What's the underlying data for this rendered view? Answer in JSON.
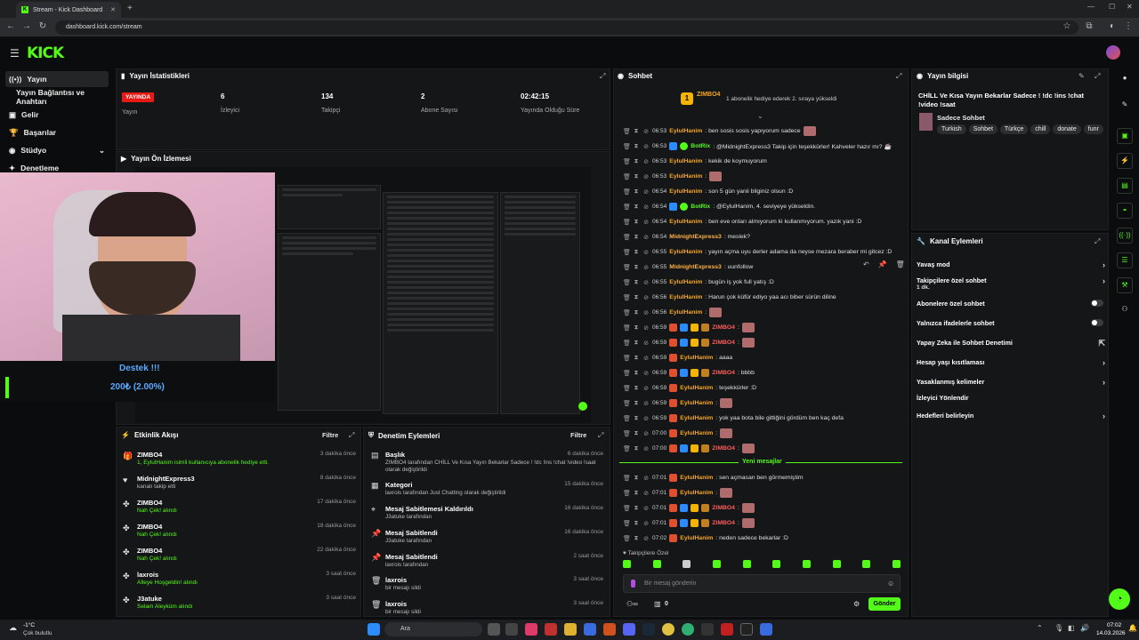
{
  "browser": {
    "tab_title": "Stream - Kick Dashboard",
    "url": "dashboard.kick.com/stream"
  },
  "brand": {
    "logo": "KICK",
    "accent": "#53fc18"
  },
  "sidebar": {
    "items": [
      {
        "label": "Yayın",
        "icon": "broadcast-icon"
      },
      {
        "label": "Yayın Bağlantısı ve Anahtarı",
        "icon": "key-icon"
      },
      {
        "label": "Gelir",
        "icon": "wallet-icon"
      },
      {
        "label": "Başarılar",
        "icon": "trophy-icon"
      },
      {
        "label": "Stüdyo",
        "icon": "studio-icon"
      },
      {
        "label": "Denetleme",
        "icon": "shield-icon"
      }
    ]
  },
  "stats": {
    "title": "Yayın İstatistikleri",
    "live_badge": "YAYINDA",
    "items": [
      {
        "label": "Yayın",
        "value": ""
      },
      {
        "label": "İzleyici",
        "value": "6"
      },
      {
        "label": "Takipçi",
        "value": "134"
      },
      {
        "label": "Abone Sayısı",
        "value": "2"
      },
      {
        "label": "Yayında Olduğu Süre",
        "value": "02:42:15"
      }
    ]
  },
  "preview": {
    "title": "Yayın Ön İzlemesi"
  },
  "overlay": {
    "goal_title": "Destek !!!",
    "goal_text": "200₺ (2.00%)"
  },
  "events": {
    "title": "Etkinlik Akışı",
    "filter": "Filtre",
    "items": [
      {
        "name": "ZIMBO4",
        "sub": "1, EylulHanim isimli kullanıcıya abonelik hediye etti.",
        "time": "3 dakika önce",
        "icon": "gift-icon"
      },
      {
        "name": "MidnightExpress3",
        "sub": "kanalı takip etti",
        "time": "8 dakika önce",
        "icon": "heart-icon"
      },
      {
        "name": "ZIMBO4",
        "sub": "Nah Çek! alındı",
        "time": "17 dakika önce",
        "icon": "reward-icon"
      },
      {
        "name": "ZIMBO4",
        "sub": "Nah Çek! alındı",
        "time": "18 dakika önce",
        "icon": "reward-icon"
      },
      {
        "name": "ZIMBO4",
        "sub": "Nah Çek! alındı",
        "time": "22 dakika önce",
        "icon": "reward-icon"
      },
      {
        "name": "laxrois",
        "sub": "Alleye Hoşgeldin! alındı",
        "time": "3 saat önce",
        "icon": "reward-icon"
      },
      {
        "name": "J3atuke",
        "sub": "Selam Aleyküm alındı",
        "time": "3 saat önce",
        "icon": "reward-icon"
      }
    ]
  },
  "modactions": {
    "title": "Denetim Eylemleri",
    "filter": "Filtre",
    "items": [
      {
        "title": "Başlık",
        "sub": "ZIMBO4 tarafından CHİLL Ve Kısa Yayın Bekarlar Sadece ! !dc !ins !chat !video !saat olarak değiştirildi",
        "time": "6 dakika önce",
        "icon": "text-icon"
      },
      {
        "title": "Kategori",
        "sub": "laxrois tarafından Just Chatting olarak değiştirildi",
        "time": "15 dakika önce",
        "icon": "category-icon"
      },
      {
        "title": "Mesaj Sabitlemesi Kaldırıldı",
        "sub": "J3atuke tarafından",
        "time": "16 dakika önce",
        "icon": "unpin-icon"
      },
      {
        "title": "Mesaj Sabitlendi",
        "sub": "J3atuke tarafından",
        "time": "16 dakika önce",
        "icon": "pin-icon"
      },
      {
        "title": "Mesaj Sabitlendi",
        "sub": "laxrois tarafından",
        "time": "2 saat önce",
        "icon": "pin-icon"
      },
      {
        "title": "laxrois",
        "sub": "bir mesajı sildi",
        "time": "3 saat önce",
        "icon": "trash-icon"
      },
      {
        "title": "laxrois",
        "sub": "bir mesajı sildi",
        "time": "3 saat önce",
        "icon": "trash-icon"
      }
    ]
  },
  "chat": {
    "title": "Sohbet",
    "pinned_user": "ZIMBO4",
    "pinned_text": "1 abonelik hediye ederek 2. sıraya yükseldi",
    "new_messages": "Yeni mesajlar",
    "followers_only": "Takipçilere Özel",
    "input_placeholder": "Bir mesaj gönderin",
    "send": "Gönder",
    "count": "0",
    "messages": [
      {
        "t": "06:53",
        "u": "EylulHanim",
        "c": "u1",
        "m": ": ben sosis sosis yapıyorum sadece",
        "e": true
      },
      {
        "t": "06:53",
        "u": "BotRix",
        "c": "u2",
        "m": ": @MidnightExpress3 Takip için teşekkürler! Kahveler hazır mı? ☕"
      },
      {
        "t": "06:53",
        "u": "EylulHanim",
        "c": "u1",
        "m": ": kekik de koymuyorum"
      },
      {
        "t": "06:53",
        "u": "EylulHanim",
        "c": "u1",
        "m": ":",
        "e": true
      },
      {
        "t": "06:54",
        "u": "EylulHanim",
        "c": "u1",
        "m": ": son 5 gün yanii bilginiz olsun :D"
      },
      {
        "t": "06:54",
        "u": "BotRix",
        "c": "u2",
        "m": ": @EylulHanim, 4. seviyeye yükseldin."
      },
      {
        "t": "06:54",
        "u": "EylulHanim",
        "c": "u1",
        "m": ": ben eve onları almıyorum ki kullanmıyorum. yazık yani :D"
      },
      {
        "t": "06:54",
        "u": "MidnightExpress3",
        "c": "u3",
        "m": ": meslek?"
      },
      {
        "t": "06:55",
        "u": "EylulHanim",
        "c": "u1",
        "m": ": yayın açma uyu derler adama da neyse mezara beraber mi gitcez :D"
      },
      {
        "t": "06:55",
        "u": "MidnightExpress3",
        "c": "u3",
        "m": ": uunfollow"
      },
      {
        "t": "06:55",
        "u": "EylulHanim",
        "c": "u1",
        "m": ": bugün iş yok full yatış :D"
      },
      {
        "t": "06:56",
        "u": "EylulHanim",
        "c": "u1",
        "m": ": Harun çok küfür ediyo yaa acı biber sürün diline"
      },
      {
        "t": "06:56",
        "u": "EylulHanim",
        "c": "u1",
        "m": ":",
        "e": true
      },
      {
        "t": "06:59",
        "u": "ZIMBO4",
        "c": "u4",
        "m": ":",
        "e": true
      },
      {
        "t": "06:59",
        "u": "ZIMBO4",
        "c": "u4",
        "m": ":",
        "e": true
      },
      {
        "t": "06:59",
        "u": "EylulHanim",
        "c": "u1",
        "m": ": aaaa"
      },
      {
        "t": "06:59",
        "u": "ZIMBO4",
        "c": "u4",
        "m": ": bbbb"
      },
      {
        "t": "06:59",
        "u": "EylulHanim",
        "c": "u1",
        "m": ": teşekkürler :D"
      },
      {
        "t": "06:59",
        "u": "EylulHanim",
        "c": "u1",
        "m": ":",
        "e": true
      },
      {
        "t": "06:59",
        "u": "EylulHanim",
        "c": "u1",
        "m": ": yok yaa bota bile gittiğini gördüm ben kaç defa"
      },
      {
        "t": "07:00",
        "u": "EylulHanim",
        "c": "u1",
        "m": ":",
        "e": true
      },
      {
        "t": "07:00",
        "u": "ZIMBO4",
        "c": "u4",
        "m": ":",
        "e": true
      }
    ],
    "messages_new": [
      {
        "t": "07:01",
        "u": "EylulHanim",
        "c": "u1",
        "m": ": sen açmasan ben görmemiştim"
      },
      {
        "t": "07:01",
        "u": "EylulHanim",
        "c": "u1",
        "m": ":",
        "e": true
      },
      {
        "t": "07:01",
        "u": "ZIMBO4",
        "c": "u4",
        "m": ":",
        "e": true
      },
      {
        "t": "07:01",
        "u": "ZIMBO4",
        "c": "u4",
        "m": ":",
        "e": true
      },
      {
        "t": "07:02",
        "u": "EylulHanim",
        "c": "u1",
        "m": ": neden sadece bekarlar :D"
      }
    ]
  },
  "streaminfo": {
    "title": "Yayın bilgisi",
    "stream_title": "CHİLL Ve Kısa Yayın Bekarlar Sadece ! !dc !ins !chat !video !saat",
    "category": "Sadece Sohbet",
    "tags": [
      "Turkish",
      "Sohbet",
      "Türkçe",
      "chill",
      "donate",
      "funr"
    ]
  },
  "channelactions": {
    "title": "Kanal Eylemleri",
    "items": [
      {
        "label": "Yavaş mod",
        "kind": "chevron"
      },
      {
        "label": "Takipçilere özel sohbet",
        "sub": "1 dk.",
        "kind": "chevron"
      },
      {
        "label": "Abonelere özel sohbet",
        "kind": "toggle"
      },
      {
        "label": "Yalnızca ifadelerle sohbet",
        "kind": "toggle"
      },
      {
        "label": "Yapay Zeka ile Sohbet Denetimi",
        "kind": "ext"
      },
      {
        "label": "Hesap yaşı kısıtlaması",
        "kind": "chevron"
      },
      {
        "label": "Yasaklanmış kelimeler",
        "kind": "chevron"
      },
      {
        "label": "İzleyici Yönlendir",
        "kind": "none"
      },
      {
        "label": "Hedefleri belirleyin",
        "kind": "chevron"
      }
    ]
  },
  "taskbar": {
    "weather_temp": "-1°C",
    "weather_text": "Çok bulutlu",
    "search": "Ara",
    "time": "07:02",
    "date": "14.03.2026"
  }
}
